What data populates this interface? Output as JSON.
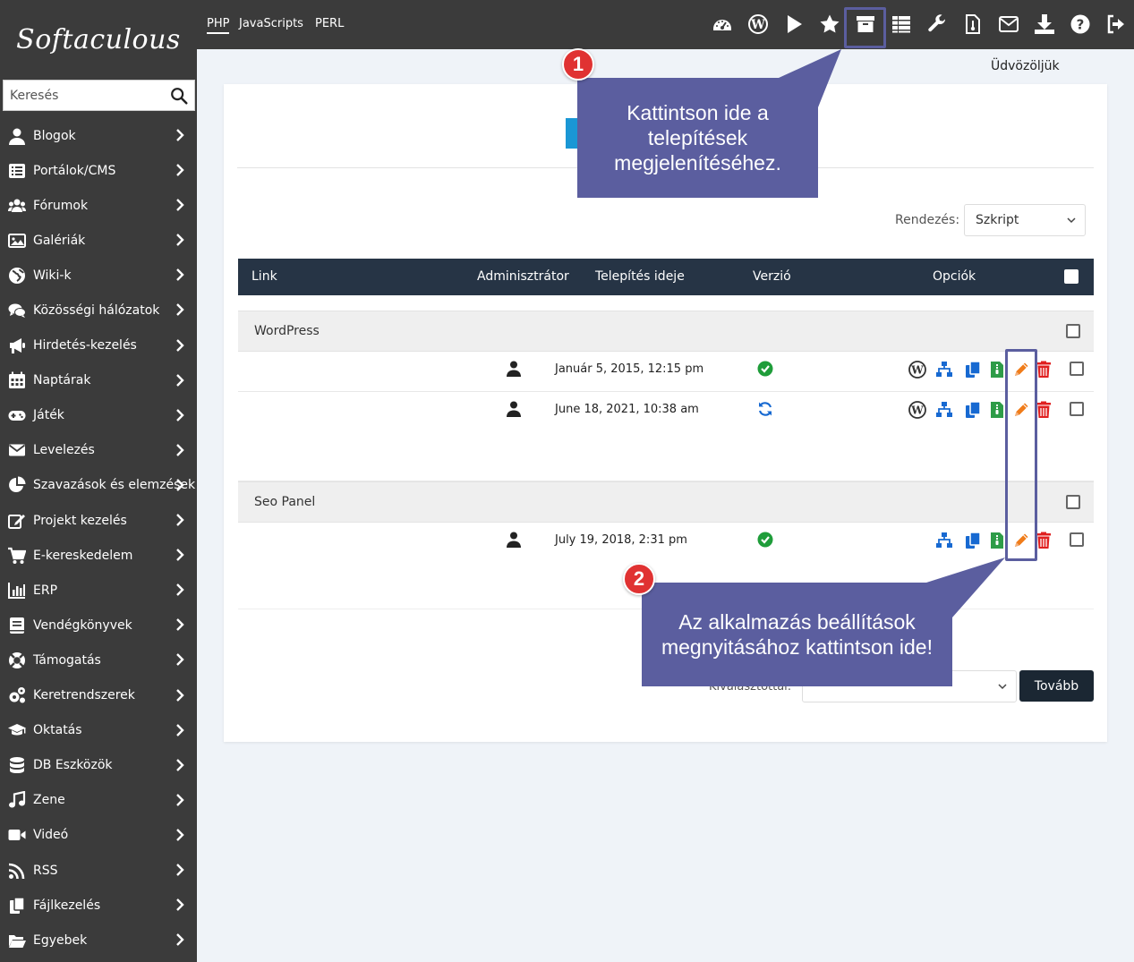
{
  "brand": {
    "logo_text": "Softaculous"
  },
  "search": {
    "placeholder": "Keresés"
  },
  "sidebar": {
    "items": [
      {
        "label": "Blogok",
        "icon": "user-icon"
      },
      {
        "label": "Portálok/CMS",
        "icon": "list-icon"
      },
      {
        "label": "Fórumok",
        "icon": "users-icon"
      },
      {
        "label": "Galériák",
        "icon": "image-icon"
      },
      {
        "label": "Wiki-k",
        "icon": "globe-icon"
      },
      {
        "label": "Közösségi hálózatok",
        "icon": "comments-icon"
      },
      {
        "label": "Hirdetés-kezelés",
        "icon": "bullhorn-icon"
      },
      {
        "label": "Naptárak",
        "icon": "calendar-icon"
      },
      {
        "label": "Játék",
        "icon": "gamepad-icon"
      },
      {
        "label": "Levelezés",
        "icon": "envelope-icon"
      },
      {
        "label": "Szavazások és elemzések",
        "icon": "pie-chart-icon"
      },
      {
        "label": "Projekt kezelés",
        "icon": "edit-icon"
      },
      {
        "label": "E-kereskedelem",
        "icon": "cart-icon"
      },
      {
        "label": "ERP",
        "icon": "bar-chart-icon"
      },
      {
        "label": "Vendégkönyvek",
        "icon": "book-icon"
      },
      {
        "label": "Támogatás",
        "icon": "lifebuoy-icon"
      },
      {
        "label": "Keretrendszerek",
        "icon": "cogs-icon"
      },
      {
        "label": "Oktatás",
        "icon": "graduation-cap-icon"
      },
      {
        "label": "DB Eszközök",
        "icon": "database-icon"
      },
      {
        "label": "Zene",
        "icon": "music-icon"
      },
      {
        "label": "Videó",
        "icon": "video-icon"
      },
      {
        "label": "RSS",
        "icon": "rss-icon"
      },
      {
        "label": "Fájlkezelés",
        "icon": "files-icon"
      },
      {
        "label": "Egyebek",
        "icon": "folder-open-icon"
      }
    ]
  },
  "topbar": {
    "tabs": [
      "PHP",
      "JavaScripts",
      "PERL"
    ],
    "icons": [
      "dashboard-icon",
      "wordpress-icon",
      "play-icon",
      "star-icon",
      "archive-icon",
      "table-list-icon",
      "wrench-icon",
      "thermometer-icon",
      "envelope-icon",
      "download-icon",
      "help-icon",
      "logout-icon"
    ]
  },
  "welcome": "Üdvözöljük",
  "sort": {
    "label": "Rendezés:",
    "value": "Szkript"
  },
  "table": {
    "headers": {
      "link": "Link",
      "admin": "Adminisztrátor",
      "time": "Telepítés ideje",
      "version": "Verzió",
      "options": "Opciók"
    },
    "groups": [
      {
        "name": "WordPress",
        "rows": [
          {
            "date": "Január 5, 2015, 12:15 pm",
            "status": "up-to-date"
          },
          {
            "date": "June 18, 2021, 10:38 am",
            "status": "update-available"
          }
        ]
      },
      {
        "name": "Seo Panel",
        "rows": [
          {
            "date": "July 19, 2018, 2:31 pm",
            "status": "up-to-date"
          }
        ]
      }
    ]
  },
  "bulk": {
    "label": "Kiválasztottal:",
    "button": "Tovább"
  },
  "callouts": {
    "one": {
      "number": "1",
      "text": "Kattintson ide a telepítések megjelenítéséhez."
    },
    "two": {
      "number": "2",
      "text": "Az alkalmazás beállítások megnyitásához kattintson ide!"
    }
  },
  "colors": {
    "sidebar": "#3b3b3b",
    "table_header": "#263445",
    "callout": "#5b5e9f",
    "badge": "#e03232",
    "ok": "#1f9d3a",
    "edit": "#f07c1a",
    "delete": "#e02020",
    "blue": "#1769d1",
    "green": "#2e9c48"
  }
}
